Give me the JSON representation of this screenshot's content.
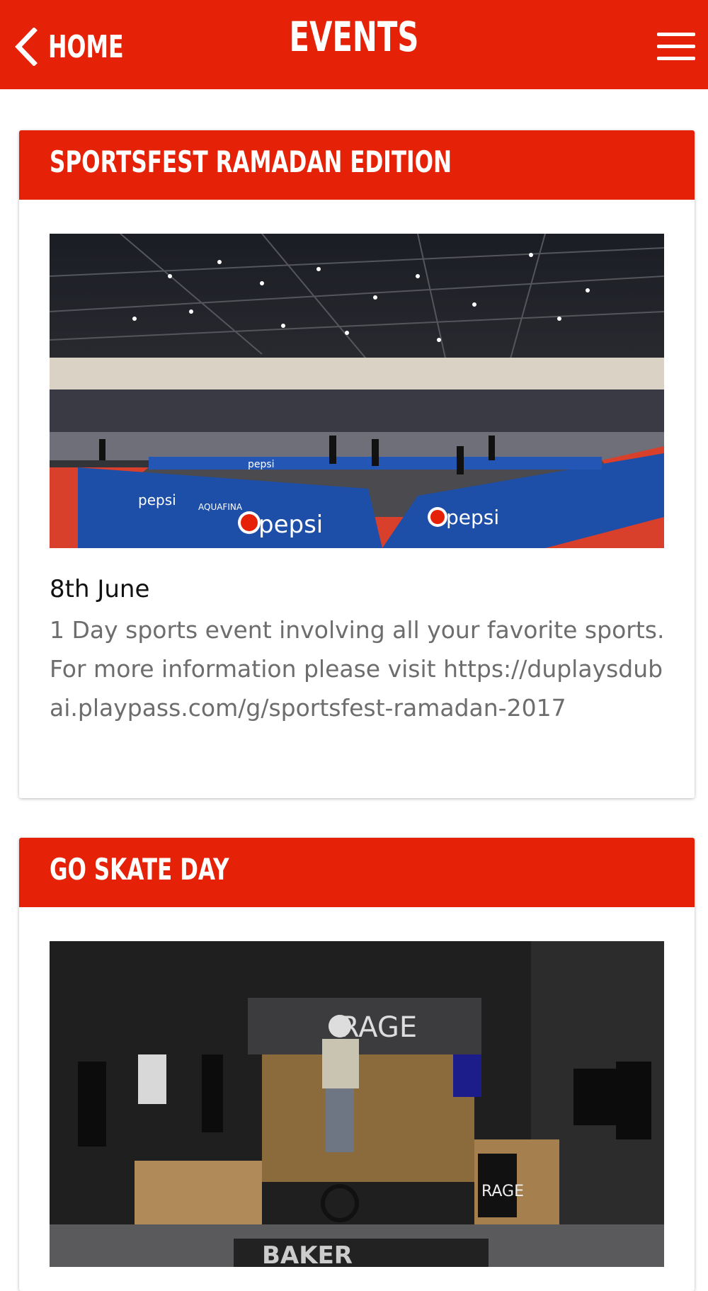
{
  "header": {
    "back_label": "HOME",
    "title": "EVENTS"
  },
  "events": [
    {
      "title": "SPORTSFEST RAMADAN EDITION",
      "date": "8th June",
      "description": "1 Day sports event involving all your favorite sports. For more information please visit https://duplaysdubai.playpass.com/g/sportsfest-ramadan-2017",
      "image_labels": [
        "pepsi",
        "pepsi",
        "pepsi",
        "pepsi",
        "AQUAFINA"
      ]
    },
    {
      "title": "GO SKATE DAY",
      "image_labels": [
        "RAGE",
        "RAGE",
        "BAKER"
      ]
    }
  ],
  "colors": {
    "brand_red": "#e52207",
    "description_gray": "#6d6d6d"
  }
}
